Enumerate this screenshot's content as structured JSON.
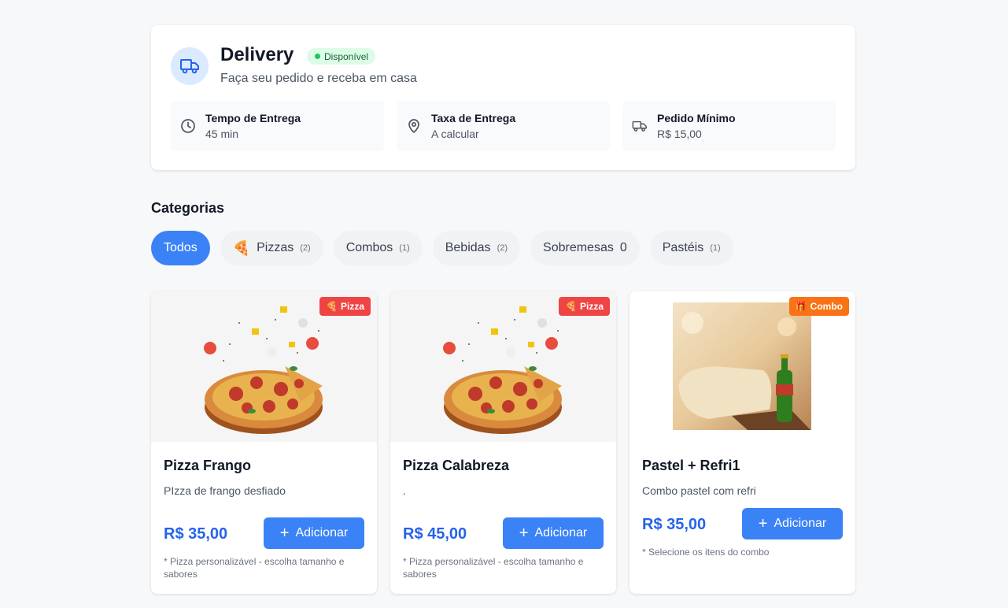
{
  "delivery": {
    "title": "Delivery",
    "status": "Disponível",
    "subtitle": "Faça seu pedido e receba em casa",
    "info": [
      {
        "label": "Tempo de Entrega",
        "value": "45 min",
        "icon": "clock-icon"
      },
      {
        "label": "Taxa de Entrega",
        "value": "A calcular",
        "icon": "map-pin-icon"
      },
      {
        "label": "Pedido Mínimo",
        "value": "R$ 15,00",
        "icon": "truck-icon"
      }
    ],
    "colors": {
      "accent": "#3b82f6",
      "status_bg": "#dcfce7",
      "status_dot": "#22c55e"
    }
  },
  "categories": {
    "title": "Categorias",
    "items": [
      {
        "label": "Todos",
        "count": ""
      },
      {
        "label": "Pizzas",
        "count": "(2)",
        "emoji": "🍕"
      },
      {
        "label": "Combos",
        "count": "(1)"
      },
      {
        "label": "Bebidas",
        "count": "(2)"
      },
      {
        "label": "Sobremesas",
        "count": "0"
      },
      {
        "label": "Pastéis",
        "count": "(1)"
      }
    ]
  },
  "products": [
    {
      "badge": "Pizza",
      "badge_emoji": "🍕",
      "badge_color": "#ef4444",
      "name": "Pizza Frango",
      "description": "PIzza de frango desfiado",
      "price": "R$ 35,00",
      "button": "Adicionar",
      "note": "* Pizza personalizável - escolha tamanho e sabores"
    },
    {
      "badge": "Pizza",
      "badge_emoji": "🍕",
      "badge_color": "#ef4444",
      "name": "Pizza Calabreza",
      "description": ".",
      "price": "R$ 45,00",
      "button": "Adicionar",
      "note": "* Pizza personalizável - escolha tamanho e sabores"
    },
    {
      "badge": "Combo",
      "badge_emoji": "🎁",
      "badge_color": "#f97316",
      "name": "Pastel + Refri1",
      "description": "Combo pastel com refri",
      "price": "R$ 35,00",
      "button": "Adicionar",
      "note": "* Selecione os itens do combo"
    }
  ]
}
